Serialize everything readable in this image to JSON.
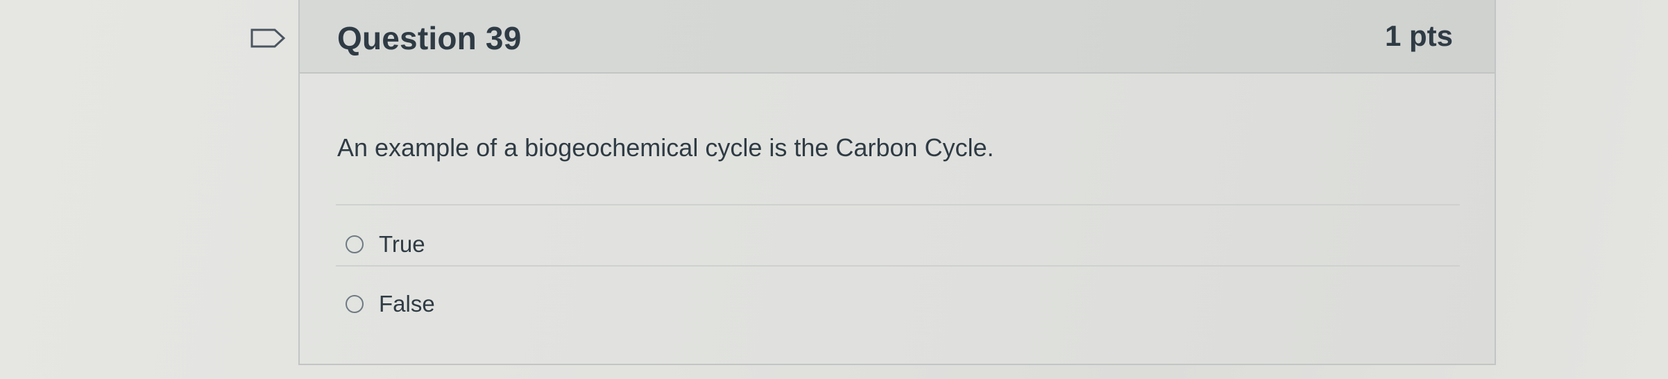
{
  "question": {
    "title": "Question 39",
    "points": "1 pts",
    "text": "An example of a biogeochemical cycle is the Carbon Cycle.",
    "flag_icon": "flag-outline-icon"
  },
  "answers": [
    {
      "label": "True",
      "selected": false
    },
    {
      "label": "False",
      "selected": false
    }
  ],
  "colors": {
    "header_bg": "#d5d7d5",
    "card_bg": "#e0e1de",
    "text": "#2f3b44",
    "border": "#c2c5c4"
  }
}
